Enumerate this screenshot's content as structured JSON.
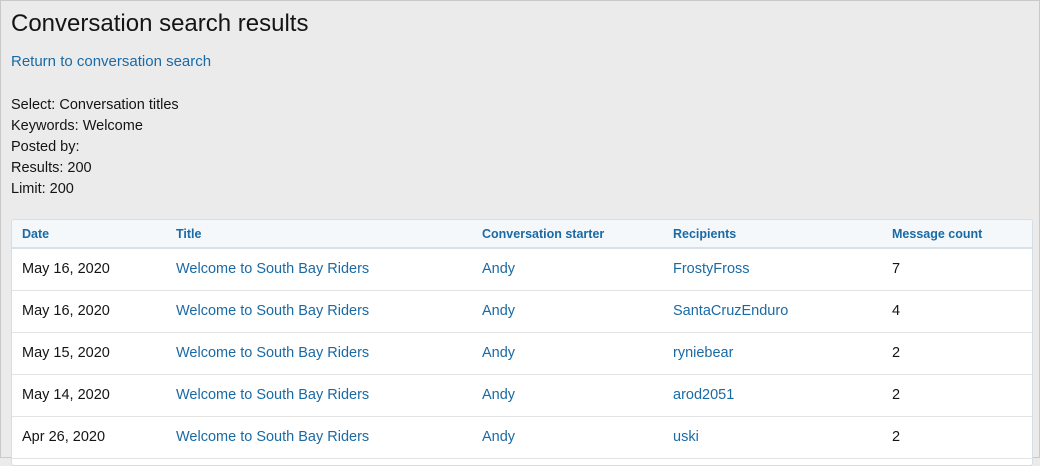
{
  "page": {
    "title": "Conversation search results",
    "return_link": "Return to conversation search"
  },
  "criteria": [
    "Select: Conversation titles",
    "Keywords: Welcome",
    "Posted by:",
    "Results: 200",
    "Limit: 200"
  ],
  "table": {
    "headers": [
      "Date",
      "Title",
      "Conversation starter",
      "Recipients",
      "Message count"
    ],
    "rows": [
      {
        "date": "May 16, 2020",
        "title": "Welcome to South Bay Riders",
        "starter": "Andy",
        "recipients": "FrostyFross",
        "count": "7"
      },
      {
        "date": "May 16, 2020",
        "title": "Welcome to South Bay Riders",
        "starter": "Andy",
        "recipients": "SantaCruzEnduro",
        "count": "4"
      },
      {
        "date": "May 15, 2020",
        "title": "Welcome to South Bay Riders",
        "starter": "Andy",
        "recipients": "ryniebear",
        "count": "2"
      },
      {
        "date": "May 14, 2020",
        "title": "Welcome to South Bay Riders",
        "starter": "Andy",
        "recipients": "arod2051",
        "count": "2"
      },
      {
        "date": "Apr 26, 2020",
        "title": "Welcome to South Bay Riders",
        "starter": "Andy",
        "recipients": "uski",
        "count": "2"
      }
    ]
  },
  "colors": {
    "link": "#1a6aa5",
    "background": "#ebebeb",
    "header_bg": "#f4f8fb"
  }
}
